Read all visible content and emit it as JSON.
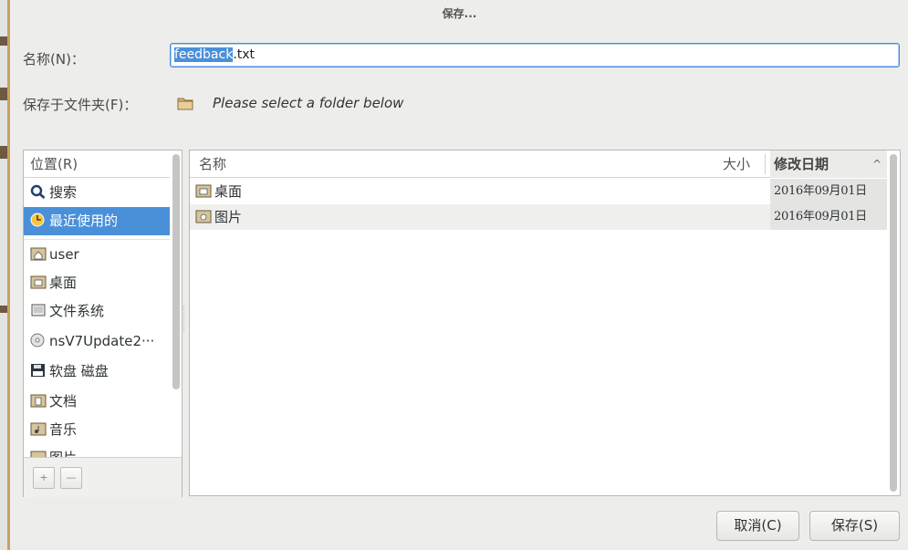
{
  "dialog": {
    "title": "保存..."
  },
  "name_field": {
    "label": "名称(N)：",
    "value_selected": "feedback",
    "value_rest": ".txt"
  },
  "folder_field": {
    "label": "保存于文件夹(F)：",
    "hint": "Please select a folder below"
  },
  "places": {
    "header": "位置(R)",
    "items": [
      {
        "label": "搜索",
        "icon": "search-icon"
      },
      {
        "label": "最近使用的",
        "icon": "recent-clock-icon"
      },
      {
        "label": "user",
        "icon": "home-folder-icon"
      },
      {
        "label": "桌面",
        "icon": "desktop-folder-icon"
      },
      {
        "label": "文件系统",
        "icon": "filesystem-icon"
      },
      {
        "label": "nsV7Update2···",
        "icon": "disc-icon"
      },
      {
        "label": "软盘 磁盘",
        "icon": "floppy-icon"
      },
      {
        "label": "文档",
        "icon": "documents-folder-icon"
      },
      {
        "label": "音乐",
        "icon": "music-folder-icon"
      },
      {
        "label": "图片",
        "icon": "pictures-folder-icon"
      }
    ],
    "add_label": "+",
    "remove_label": "—"
  },
  "files": {
    "columns": {
      "name": "名称",
      "size": "大小",
      "date": "修改日期",
      "sort_indicator": "^"
    },
    "rows": [
      {
        "name": "桌面",
        "date": "2016年09月01日",
        "icon": "desktop-folder-icon"
      },
      {
        "name": "图片",
        "date": "2016年09月01日",
        "icon": "pictures-folder-icon"
      }
    ]
  },
  "buttons": {
    "cancel": "取消(C)",
    "save": "保存(S)"
  },
  "colors": {
    "accent": "#4a90d9",
    "background": "#ededeb"
  }
}
